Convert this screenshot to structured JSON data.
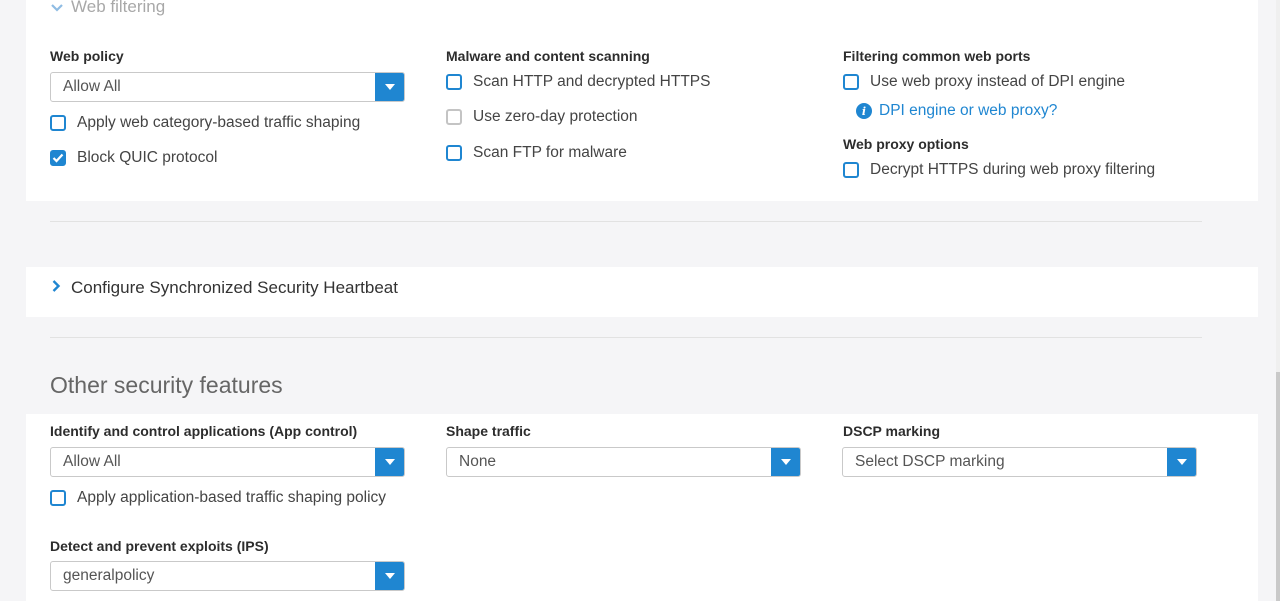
{
  "web_filtering": {
    "title": "Web filtering",
    "web_policy_label": "Web policy",
    "web_policy_value": "Allow All",
    "apply_shaping_label": "Apply web category-based traffic shaping",
    "apply_shaping_checked": false,
    "block_quic_label": "Block QUIC protocol",
    "block_quic_checked": true,
    "malware_label": "Malware and content scanning",
    "scan_http_label": "Scan HTTP and decrypted HTTPS",
    "zero_day_label": "Use zero-day protection",
    "scan_ftp_label": "Scan FTP for malware",
    "ports_label": "Filtering common web ports",
    "use_proxy_label": "Use web proxy instead of DPI engine",
    "dpi_link": "DPI engine or web proxy?",
    "proxy_options_label": "Web proxy options",
    "decrypt_https_label": "Decrypt HTTPS during web proxy filtering"
  },
  "heartbeat": {
    "title": "Configure Synchronized Security Heartbeat"
  },
  "other": {
    "title": "Other security features",
    "app_control_label": "Identify and control applications (App control)",
    "app_control_value": "Allow All",
    "app_shaping_label": "Apply application-based traffic shaping policy",
    "shape_traffic_label": "Shape traffic",
    "shape_traffic_value": "None",
    "dscp_label": "DSCP marking",
    "dscp_value": "Select DSCP marking",
    "ips_label": "Detect and prevent exploits (IPS)",
    "ips_value": "generalpolicy"
  },
  "colors": {
    "accent": "#1f86d1",
    "disabled": "#c4c4c4"
  },
  "icons": [
    "chevron-down-icon",
    "chevron-right-icon",
    "info-icon",
    "checkmark-icon",
    "dropdown-caret-icon"
  ]
}
